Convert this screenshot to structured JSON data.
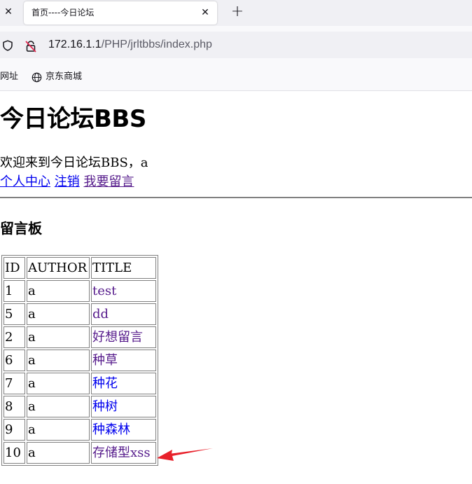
{
  "browser": {
    "tab": {
      "title": "首页----今日论坛"
    },
    "url": {
      "host": "172.16.1.1",
      "path": "/PHP/jrltbbs/index.php"
    },
    "bookmarks": [
      {
        "label": "网址"
      },
      {
        "label": "京东商城"
      }
    ]
  },
  "page": {
    "title": "今日论坛BBS",
    "welcome": "欢迎来到今日论坛BBS，a",
    "links": {
      "profile": "个人中心",
      "logout": "注销",
      "post": "我要留言"
    },
    "board_title": "留言板",
    "table": {
      "headers": [
        "ID",
        "AUTHOR",
        "TITLE"
      ],
      "rows": [
        {
          "id": "1",
          "author": "a",
          "title": "test"
        },
        {
          "id": "5",
          "author": "a",
          "title": "dd"
        },
        {
          "id": "2",
          "author": "a",
          "title": "好想留言"
        },
        {
          "id": "6",
          "author": "a",
          "title": "种草"
        },
        {
          "id": "7",
          "author": "a",
          "title": "种花"
        },
        {
          "id": "8",
          "author": "a",
          "title": "种树"
        },
        {
          "id": "9",
          "author": "a",
          "title": "种森林"
        },
        {
          "id": "10",
          "author": "a",
          "title": "存储型xss"
        }
      ]
    }
  },
  "colors": {
    "link": "#0000ee",
    "visited_link": "#551a8b",
    "annotation_arrow": "#e8212b"
  }
}
